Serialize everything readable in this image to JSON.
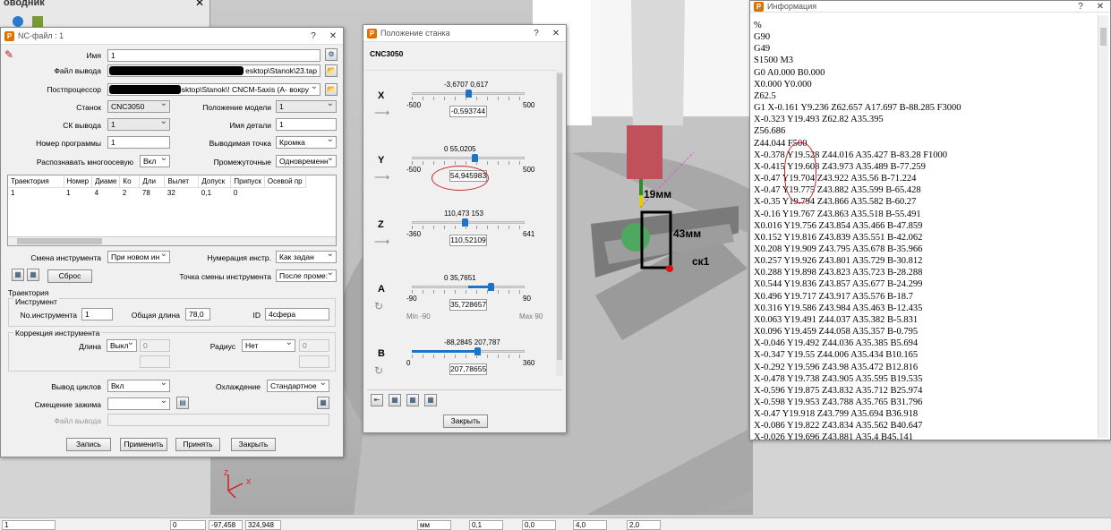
{
  "explorer": {
    "title": "оводник"
  },
  "nc_dialog": {
    "title": "NC-файл : 1",
    "name_label": "Имя",
    "name_value": "1",
    "output_label": "Файл вывода",
    "output_value": "esktop\\Stanok\\23.tap",
    "post_label": "Постпроцессор",
    "post_value": "Desktop\\Stanok\\! CNCM-5axis (A- вокру",
    "machine_label": "Станок",
    "machine_value": "CNC3050",
    "model_pos_label": "Положение модели",
    "model_pos_value": "1",
    "ck_label": "СК вывода",
    "ck_value": "1",
    "part_name_label": "Имя детали",
    "part_name_value": "1",
    "prog_num_label": "Номер программы",
    "prog_num_value": "1",
    "out_point_label": "Выводимая точка",
    "out_point_value": "Кромка",
    "multiaxis_label": "Распознавать многоосевую",
    "multiaxis_value": "Вкл",
    "intermediate_label": "Промежуточные",
    "intermediate_value": "Одновременн",
    "table_headers": [
      "Траектория",
      "Номер",
      "Диаме",
      "Ко",
      "Дли",
      "Вылет",
      "Допуск",
      "Припуск",
      "Осевой пр"
    ],
    "table_row": [
      "1",
      "1",
      "4",
      "2",
      "78",
      "32",
      "0,1",
      "0",
      ""
    ],
    "tool_change_label": "Смена инструмента",
    "tool_change_value": "При новом ин",
    "tool_num_label": "Нумерация инстр.",
    "tool_num_value": "Как задан",
    "reset_label": "Сброс",
    "tool_change_point_label": "Точка смены инструмента",
    "tool_change_point_value": "После проме:",
    "trajectory_group": "Траектория",
    "tool_group": "Инструмент",
    "tool_no_label": "No.инструмента",
    "tool_no_value": "1",
    "total_len_label": "Общая длина",
    "total_len_value": "78,0",
    "id_label": "ID",
    "id_value": "4сфера",
    "correction_group": "Коррекция инструмента",
    "length_label": "Длина",
    "length_value": "Выкл",
    "length_num": "0",
    "radius_label": "Радиус",
    "radius_value": "Нет",
    "radius_num": "0",
    "cycles_label": "Вывод циклов",
    "cycles_value": "Вкл",
    "cooling_label": "Охлаждение",
    "cooling_value": "Стандартное",
    "clamp_label": "Смещение зажима",
    "out_file_label": "Файл вывода",
    "btn_write": "Запись",
    "btn_apply": "Применить",
    "btn_accept": "Принять",
    "btn_close": "Закрыть"
  },
  "machine_dialog": {
    "title": "Положение станка",
    "name": "CNC3050",
    "axes": [
      {
        "letter": "X",
        "min": "-500",
        "max": "500",
        "marks": "-3,6707  0,617",
        "value": "-0,593744",
        "frac": 0.499
      },
      {
        "letter": "Y",
        "min": "-500",
        "max": "500",
        "marks": "0   55,0205",
        "value": "54,945983",
        "frac": 0.555
      },
      {
        "letter": "Z",
        "min": "-360",
        "max": "641",
        "marks": "110,473  153",
        "value": "110,52109",
        "frac": 0.47
      },
      {
        "letter": "A",
        "min": "-90",
        "max": "90",
        "marks": "0     35,7651",
        "value": "35,728657",
        "frac": 0.699,
        "minlab": "Min -90",
        "maxlab": "Max 90"
      },
      {
        "letter": "B",
        "min": "0",
        "max": "360",
        "marks": "-88,2845            207,787",
        "value": "207,78655",
        "frac": 0.577
      }
    ],
    "close_label": "Закрыть"
  },
  "info": {
    "title": "Информация",
    "lines": [
      "%",
      "G90",
      "G49",
      "S1500 M3",
      "G0 A0.000 B0.000",
      "X0.000 Y0.000",
      "Z62.5",
      "G1 X-0.161 Y9.236 Z62.657 A17.697 B-88.285 F3000",
      "X-0.323 Y19.493 Z62.82 A35.395",
      "Z56.686",
      "Z44.044 F500",
      "X-0.378 Y19.528 Z44.016 A35.427 B-83.28 F1000",
      "X-0.415 Y19.608 Z43.973 A35.489 B-77.259",
      "X-0.47 Y19.704 Z43.922 A35.56 B-71.224",
      "X-0.47 Y19.775 Z43.882 A35.599 B-65.428",
      "X-0.35 Y19.794 Z43.866 A35.582 B-60.27",
      "X-0.16 Y19.767 Z43.863 A35.518 B-55.491",
      "X0.016 Y19.756 Z43.854 A35.466 B-47.859",
      "X0.152 Y19.816 Z43.839 A35.551 B-42.062",
      "X0.208 Y19.909 Z43.795 A35.678 B-35.966",
      "X0.257 Y19.926 Z43.801 A35.729 B-30.812",
      "X0.288 Y19.898 Z43.823 A35.723 B-28.288",
      "X0.544 Y19.836 Z43.857 A35.677 B-24.299",
      "X0.496 Y19.717 Z43.917 A35.576 B-18.7",
      "X0.316 Y19.586 Z43.984 A35.463 B-12.435",
      "X0.063 Y19.491 Z44.037 A35.382 B-5.831",
      "X0.096 Y19.459 Z44.058 A35.357 B-0.795",
      "X-0.046 Y19.492 Z44.036 A35.385 B5.694",
      "X-0.347 Y19.55 Z44.006 A35.434 B10.165",
      "X-0.292 Y19.596 Z43.98 A35.472 B12.816",
      "X-0.478 Y19.738 Z43.905 A35.595 B19.535",
      "X-0.596 Y19.875 Z43.832 A35.712 B25.974",
      "X-0.598 Y19.953 Z43.788 A35.765 B31.796",
      "X-0.47 Y19.918 Z43.799 A35.694 B36.918",
      "X-0.086 Y19.822 Z43.834 A35.562 B40.647",
      "X-0.026 Y19.696 Z43.881 A35.4 B45.141"
    ]
  },
  "annotations": {
    "dim1": "19мм",
    "dim2": "43мм",
    "sk": "ск1"
  },
  "status": {
    "layer": "1",
    "f1": "0",
    "f2": "-97,458",
    "f3": "324,948",
    "unit": "мм",
    "v1": "0,1",
    "v2": "0,0",
    "v3": "4,0",
    "v4": "2,0"
  }
}
